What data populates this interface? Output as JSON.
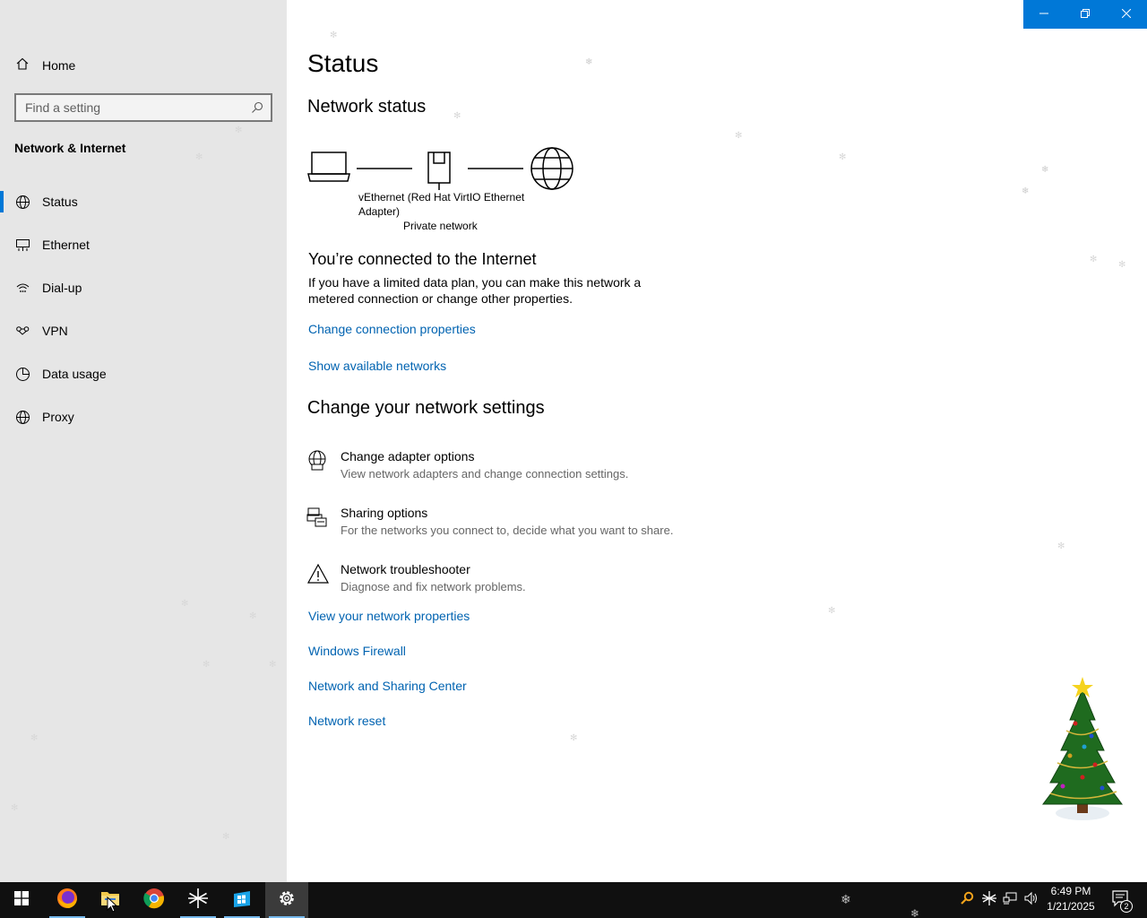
{
  "window": {
    "minimize_icon": "minimize-icon",
    "restore_icon": "restore-icon",
    "close_icon": "close-icon",
    "accent": "#0078d7"
  },
  "sidebar": {
    "home_label": "Home",
    "search_placeholder": "Find a setting",
    "section_title": "Network & Internet",
    "items": [
      {
        "label": "Status",
        "icon": "status-globe-icon",
        "active": true
      },
      {
        "label": "Ethernet",
        "icon": "ethernet-icon"
      },
      {
        "label": "Dial-up",
        "icon": "dialup-icon"
      },
      {
        "label": "VPN",
        "icon": "vpn-icon"
      },
      {
        "label": "Data usage",
        "icon": "data-usage-icon"
      },
      {
        "label": "Proxy",
        "icon": "proxy-globe-icon"
      }
    ]
  },
  "main": {
    "title": "Status",
    "network_status_heading": "Network status",
    "adapter_name": "vEthernet (Red Hat VirtIO Ethernet Adapter)",
    "network_type": "Private network",
    "connected_heading": "You’re connected to the Internet",
    "connected_desc": "If you have a limited data plan, you can make this network a metered connection or change other properties.",
    "link_change_props": "Change connection properties",
    "link_show_networks": "Show available networks",
    "change_settings_heading": "Change your network settings",
    "settings": [
      {
        "title": "Change adapter options",
        "desc": "View network adapters and change connection settings.",
        "icon": "adapter-globe-icon"
      },
      {
        "title": "Sharing options",
        "desc": "For the networks you connect to, decide what you want to share.",
        "icon": "sharing-printer-icon"
      },
      {
        "title": "Network troubleshooter",
        "desc": "Diagnose and fix network problems.",
        "icon": "warning-icon"
      }
    ],
    "links": [
      "View your network properties",
      "Windows Firewall",
      "Network and Sharing Center",
      "Network reset"
    ],
    "link_color": "#0063b1"
  },
  "taskbar": {
    "apps": [
      {
        "icon": "windows-start-icon"
      },
      {
        "icon": "firefox-icon",
        "running": true
      },
      {
        "icon": "file-explorer-icon"
      },
      {
        "icon": "chrome-icon"
      },
      {
        "icon": "snowflake-app-icon",
        "running": true
      },
      {
        "icon": "store-icon",
        "running": true
      },
      {
        "icon": "settings-gear-icon",
        "running": true,
        "active": true
      }
    ],
    "clock_time": "6:49 PM",
    "clock_date": "1/21/2025",
    "notification_count": "2"
  }
}
